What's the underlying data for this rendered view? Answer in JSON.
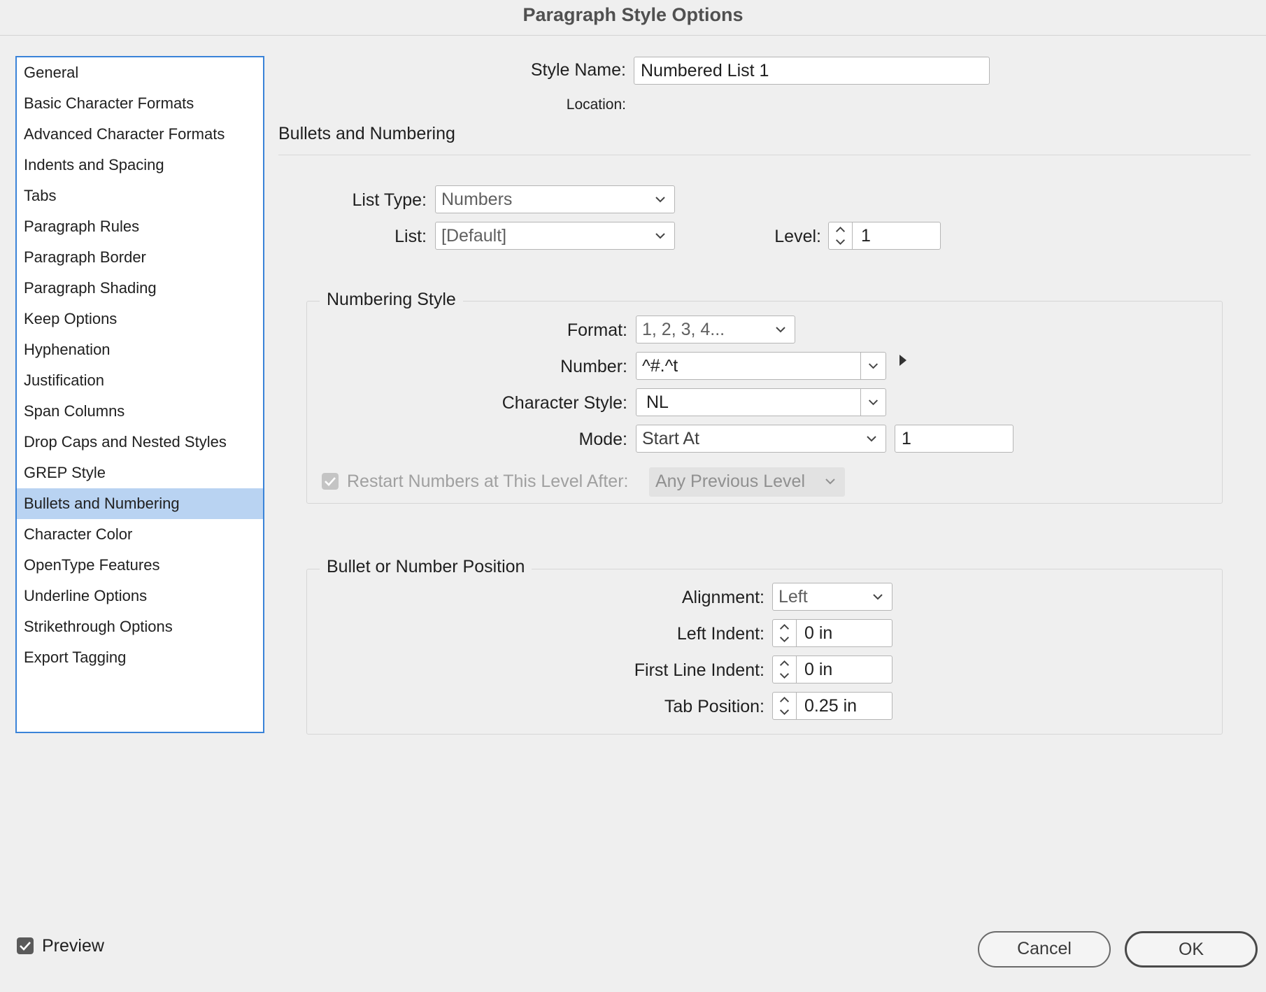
{
  "window": {
    "title": "Paragraph Style Options"
  },
  "sidebar": {
    "items": [
      {
        "label": "General"
      },
      {
        "label": "Basic Character Formats"
      },
      {
        "label": "Advanced Character Formats"
      },
      {
        "label": "Indents and Spacing"
      },
      {
        "label": "Tabs"
      },
      {
        "label": "Paragraph Rules"
      },
      {
        "label": "Paragraph Border"
      },
      {
        "label": "Paragraph Shading"
      },
      {
        "label": "Keep Options"
      },
      {
        "label": "Hyphenation"
      },
      {
        "label": "Justification"
      },
      {
        "label": "Span Columns"
      },
      {
        "label": "Drop Caps and Nested Styles"
      },
      {
        "label": "GREP Style"
      },
      {
        "label": "Bullets and Numbering",
        "selected": true
      },
      {
        "label": "Character Color"
      },
      {
        "label": "OpenType Features"
      },
      {
        "label": "Underline Options"
      },
      {
        "label": "Strikethrough Options"
      },
      {
        "label": "Export Tagging"
      }
    ]
  },
  "header": {
    "style_name_label": "Style Name:",
    "style_name_value": "Numbered List 1",
    "location_label": "Location:"
  },
  "section": {
    "title": "Bullets and Numbering"
  },
  "list_settings": {
    "list_type_label": "List Type:",
    "list_type_value": "Numbers",
    "list_label": "List:",
    "list_value": "[Default]",
    "level_label": "Level:",
    "level_value": "1"
  },
  "numbering_style": {
    "title": "Numbering Style",
    "format_label": "Format:",
    "format_value": "1, 2, 3, 4...",
    "number_label": "Number:",
    "number_value": "^#.^t",
    "char_style_label": "Character Style:",
    "char_style_value": "NL",
    "mode_label": "Mode:",
    "mode_value": "Start At",
    "start_at_value": "1",
    "restart_label": "Restart Numbers at This Level After:",
    "restart_checked": true,
    "restart_value": "Any Previous Level"
  },
  "position": {
    "title": "Bullet or Number Position",
    "alignment_label": "Alignment:",
    "alignment_value": "Left",
    "left_indent_label": "Left Indent:",
    "left_indent_value": "0 in",
    "first_line_label": "First Line Indent:",
    "first_line_value": "0 in",
    "tab_position_label": "Tab Position:",
    "tab_position_value": "0.25 in"
  },
  "footer": {
    "preview_label": "Preview",
    "preview_checked": true,
    "cancel_label": "Cancel",
    "ok_label": "OK"
  },
  "colors": {
    "accent": "#3a83d8",
    "selection": "#b9d3f2",
    "checkbox": "#5a5a5a"
  }
}
